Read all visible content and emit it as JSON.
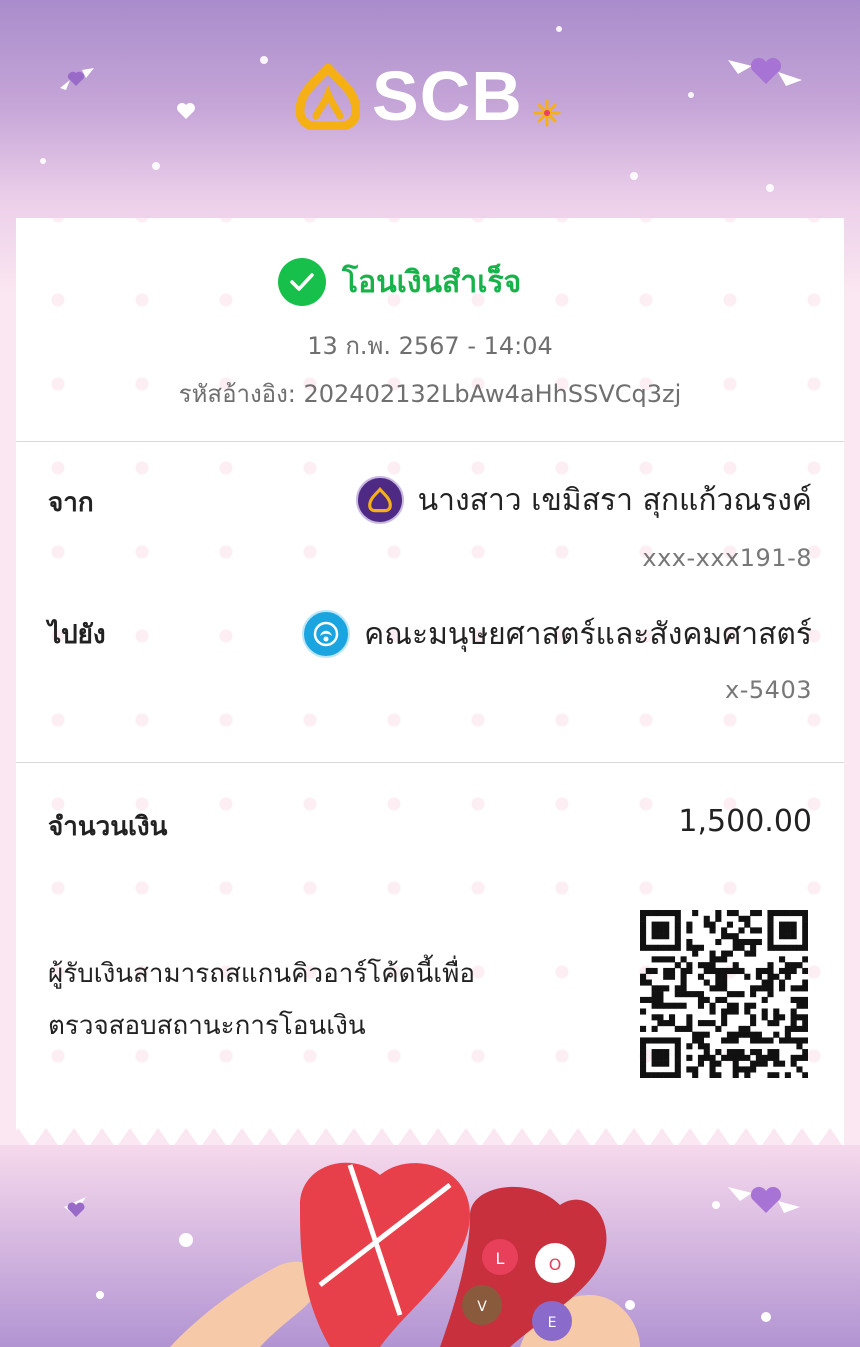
{
  "brand": {
    "name": "SCB"
  },
  "status": {
    "text": "โอนเงินสำเร็จ",
    "color": "#17c04a"
  },
  "transaction": {
    "datetime": "13 ก.พ. 2567 - 14:04",
    "reference": "รหัสอ้างอิง: 202402132LbAw4aHhSSVCq3zj"
  },
  "from": {
    "label": "จาก",
    "name": "นางสาว เขมิสรา สุกแก้วณรงค์",
    "account": "xxx-xxx191-8",
    "bank_icon": "scb-bank-icon"
  },
  "to": {
    "label": "ไปยัง",
    "name": "คณะมนุษยศาสตร์และสังคมศาสตร์",
    "account": "x-5403",
    "bank_icon": "ktb-bank-icon"
  },
  "amount": {
    "label": "จำนวนเงิน",
    "value": "1,500.00"
  },
  "qr": {
    "text_line1": "ผู้รับเงินสามารถสแกนคิวอาร์โค้ดนี้เพื่อ",
    "text_line2": "ตรวจสอบสถานะการโอนเงิน",
    "icon": "qr-code"
  },
  "colors": {
    "brand_purple": "#4e2a84",
    "brand_gold": "#f5b015",
    "success_green": "#17c04a",
    "ktb_blue": "#1aa5e0"
  }
}
